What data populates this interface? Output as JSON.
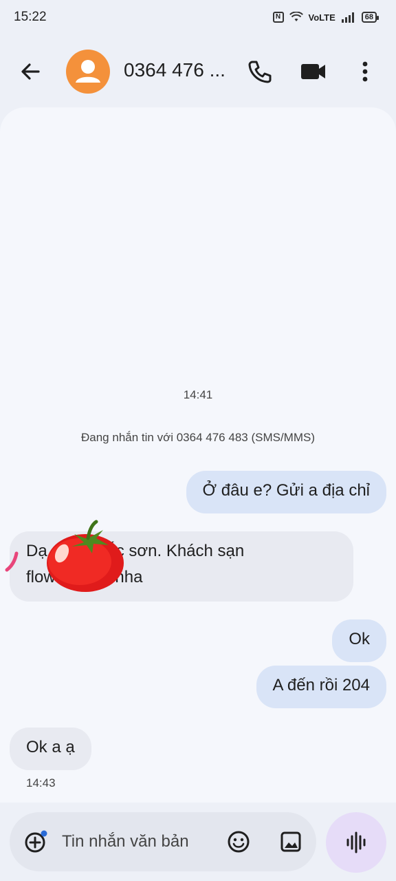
{
  "status_bar": {
    "time": "15:22",
    "nfc_label": "N",
    "network_label": "VoLTE",
    "battery_level": "68"
  },
  "app_bar": {
    "contact_name": "0364 476 ...",
    "icons": [
      "back-arrow-icon",
      "avatar-person-icon",
      "phone-icon",
      "video-camera-icon",
      "more-vert-icon"
    ],
    "avatar_color": "#f4913b"
  },
  "conversation": {
    "top_timestamp": "14:41",
    "info_line": "Đang nhắn tin với 0364 476 483 (SMS/MMS)",
    "messages": [
      {
        "direction": "outgoing",
        "text": "Ở đâu e? Gửi a địa chỉ"
      },
      {
        "direction": "incoming",
        "line1": "Dạ        1 bắc sơn. Khách sạn",
        "line2": "flow          A nha"
      },
      {
        "direction": "outgoing",
        "text": "Ok"
      },
      {
        "direction": "outgoing",
        "text": "A đến rồi 204"
      },
      {
        "direction": "incoming",
        "text": "Ok a ạ"
      }
    ],
    "last_timestamp": "14:43",
    "outgoing_bubble_color": "#d9e4f7",
    "incoming_bubble_color": "#e8eaf1"
  },
  "composer": {
    "placeholder": "Tin nhắn văn bản",
    "icons": [
      "add-circle-icon",
      "emoji-icon",
      "image-icon",
      "voice-waveform-icon"
    ],
    "voice_button_color": "#e6dcf8"
  }
}
